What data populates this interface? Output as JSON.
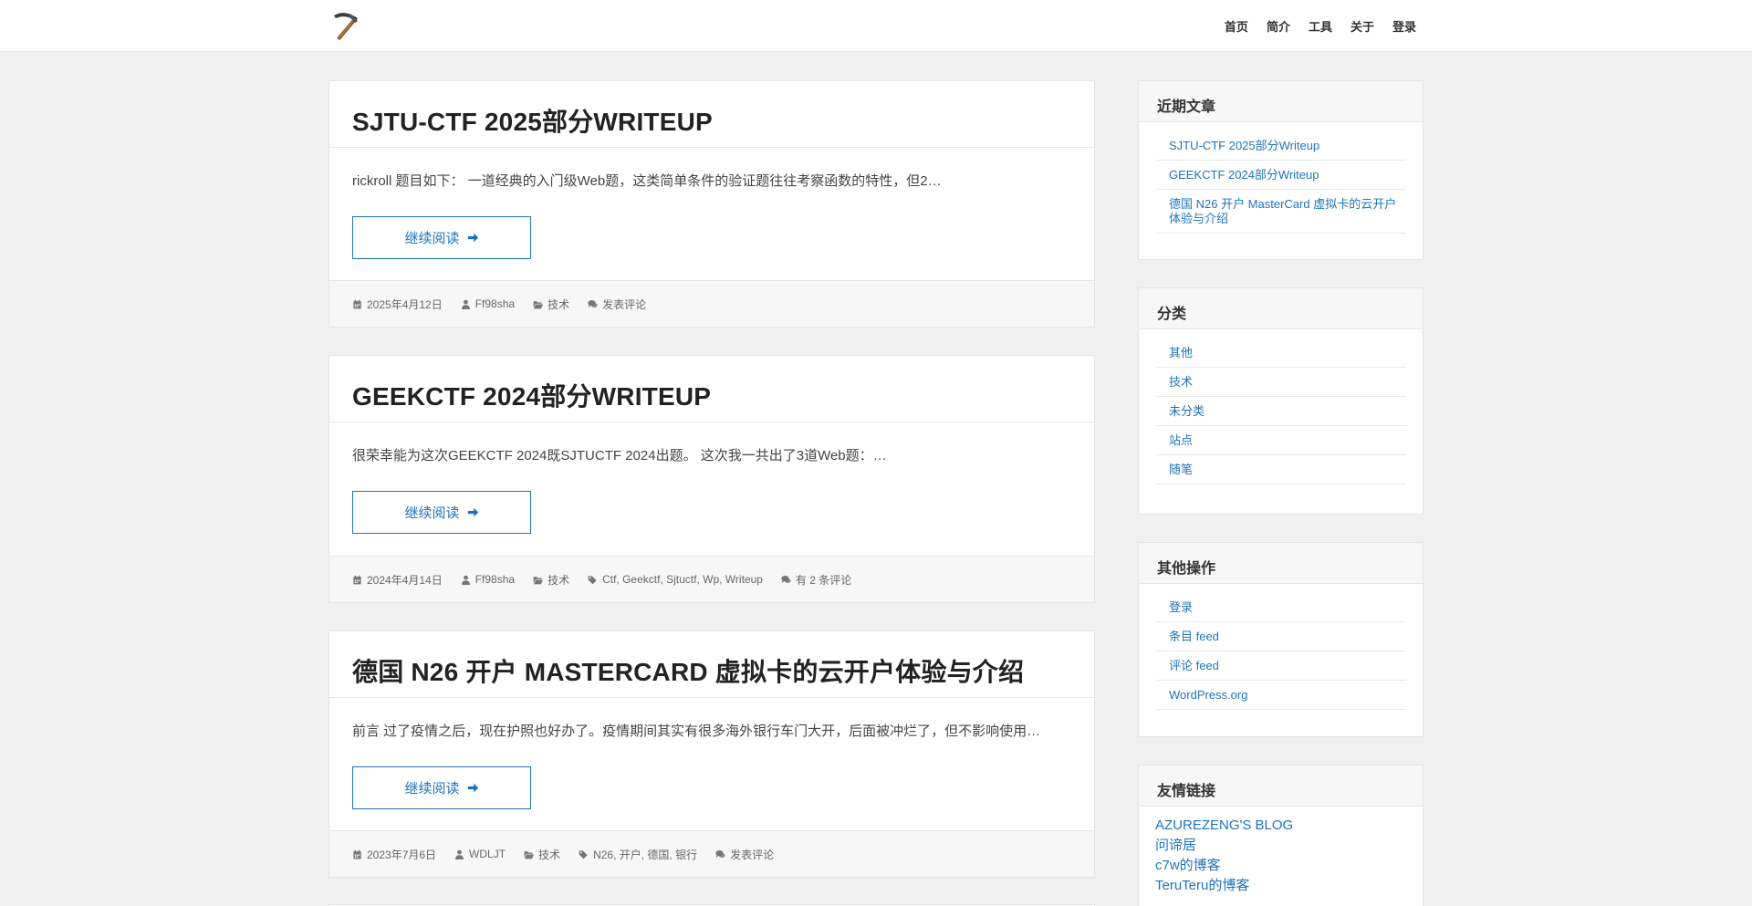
{
  "nav": {
    "items": [
      "首页",
      "简介",
      "工具",
      "关于",
      "登录"
    ]
  },
  "icons": {
    "logo": "pickaxe-icon",
    "date": "calendar-icon",
    "author": "user-icon",
    "category": "folder-open-icon",
    "tags": "tags-icon",
    "comments": "comments-icon",
    "read_more": "arrow-right-icon"
  },
  "colors": {
    "accent": "#1e73be",
    "background": "#f0f0f0"
  },
  "posts": [
    {
      "title": "SJTU-CTF 2025部分WRITEUP",
      "excerpt": "rickroll 题目如下： 一道经典的入门级Web题，这类简单条件的验证题往往考察函数的特性，但2…",
      "read_more": "继续阅读",
      "date": "2025年4月12日",
      "author": "Ff98sha",
      "category": "技术",
      "tags": "",
      "comments": "发表评论"
    },
    {
      "title": "GEEKCTF 2024部分WRITEUP",
      "excerpt": "很荣幸能为这次GEEKCTF 2024既SJTUCTF 2024出题。 这次我一共出了3道Web题：…",
      "read_more": "继续阅读",
      "date": "2024年4月14日",
      "author": "Ff98sha",
      "category": "技术",
      "tags": "Ctf, Geekctf, Sjtuctf, Wp, Writeup",
      "comments": "有 2 条评论"
    },
    {
      "title": "德国 N26 开户 MASTERCARD 虚拟卡的云开户体验与介绍",
      "excerpt": "前言 过了疫情之后，现在护照也好办了。疫情期间其实有很多海外银行车门大开，后面被冲烂了，但不影响使用…",
      "read_more": "继续阅读",
      "date": "2023年7月6日",
      "author": "WDLJT",
      "category": "技术",
      "tags": "N26, 开户, 德国, 银行",
      "comments": "发表评论"
    }
  ],
  "sidebar": {
    "recent": {
      "title": "近期文章",
      "items": [
        "SJTU-CTF 2025部分Writeup",
        "GEEKCTF 2024部分Writeup",
        "德国 N26 开户 MasterCard 虚拟卡的云开户体验与介绍"
      ]
    },
    "categories": {
      "title": "分类",
      "items": [
        "其他",
        "技术",
        "未分类",
        "站点",
        "随笔"
      ]
    },
    "meta": {
      "title": "其他操作",
      "items": [
        "登录",
        "条目 feed",
        "评论 feed",
        "WordPress.org"
      ]
    },
    "links": {
      "title": "友情链接",
      "items": [
        "AZUREZENG'S BLOG",
        "问谛居",
        "c7w的博客",
        "TeruTeru的博客"
      ]
    }
  }
}
